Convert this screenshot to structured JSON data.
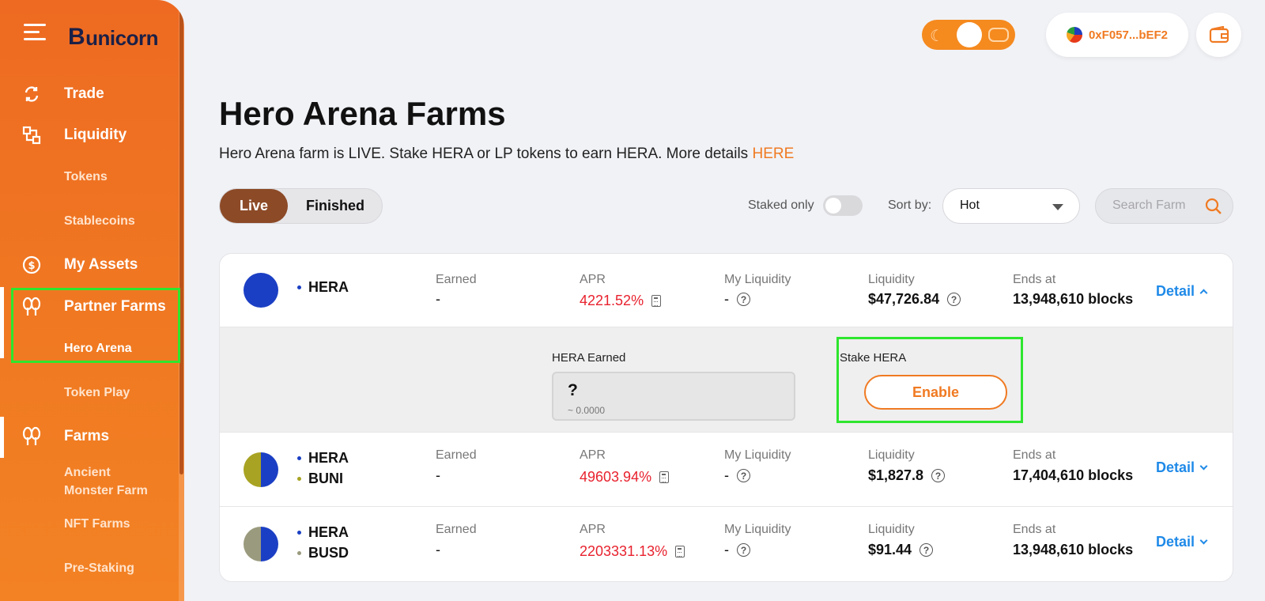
{
  "brand": {
    "name": "unicorn",
    "initial": "B"
  },
  "sidebar": {
    "items": [
      {
        "id": "trade",
        "label": "Trade"
      },
      {
        "id": "liquidity",
        "label": "Liquidity"
      },
      {
        "id": "tokens",
        "label": "Tokens"
      },
      {
        "id": "stablecoins",
        "label": "Stablecoins"
      },
      {
        "id": "my-assets",
        "label": "My Assets"
      },
      {
        "id": "partner-farms",
        "label": "Partner Farms"
      },
      {
        "id": "hero-arena",
        "label": "Hero Arena"
      },
      {
        "id": "token-play",
        "label": "Token Play"
      },
      {
        "id": "farms",
        "label": "Farms"
      },
      {
        "id": "ancient-monster-farm",
        "label": "Ancient Monster Farm"
      },
      {
        "id": "nft-farms",
        "label": "NFT Farms"
      },
      {
        "id": "pre-staking",
        "label": "Pre-Staking"
      }
    ]
  },
  "header": {
    "wallet_address": "0xF057...bEF2"
  },
  "page": {
    "title": "Hero Arena Farms",
    "subtitle": "Hero Arena farm is LIVE. Stake HERA or LP tokens to earn HERA. More details ",
    "subtitle_link": "HERE"
  },
  "filters": {
    "tabs": [
      "Live",
      "Finished"
    ],
    "active_tab": "Live",
    "staked_only_label": "Staked only",
    "staked_only": false,
    "sort_label": "Sort by:",
    "sort_value": "Hot",
    "search_placeholder": "Search Farm"
  },
  "columns": {
    "earned": "Earned",
    "apr": "APR",
    "my_liquidity": "My Liquidity",
    "liquidity": "Liquidity",
    "ends_at": "Ends at",
    "detail": "Detail"
  },
  "farms": [
    {
      "tokens": [
        "HERA"
      ],
      "earned": "-",
      "apr": "4221.52%",
      "my_liquidity": "-",
      "liquidity": "$47,726.84",
      "ends_at": "13,948,610 blocks",
      "expanded": true
    },
    {
      "tokens": [
        "HERA",
        "BUNI"
      ],
      "earned": "-",
      "apr": "49603.94%",
      "my_liquidity": "-",
      "liquidity": "$1,827.8",
      "ends_at": "17,404,610 blocks",
      "expanded": false
    },
    {
      "tokens": [
        "HERA",
        "BUSD"
      ],
      "earned": "-",
      "apr": "2203331.13%",
      "my_liquidity": "-",
      "liquidity": "$91.44",
      "ends_at": "13,948,610 blocks",
      "expanded": false
    }
  ],
  "expanded_panel": {
    "earned_label": "HERA Earned",
    "earned_value": "?",
    "earned_approx": "~ 0.0000",
    "stake_label": "Stake HERA",
    "enable_label": "Enable"
  },
  "colors": {
    "sidebar": "#ee6a22",
    "accent": "#f07a22",
    "active_tab": "#8c4a27",
    "apr": "#e8222e",
    "link": "#1f8ae8",
    "highlight": "#2ee62e",
    "hera": "#1b3fc4",
    "buni": "#a8a322",
    "busd": "#9a9a7e"
  }
}
